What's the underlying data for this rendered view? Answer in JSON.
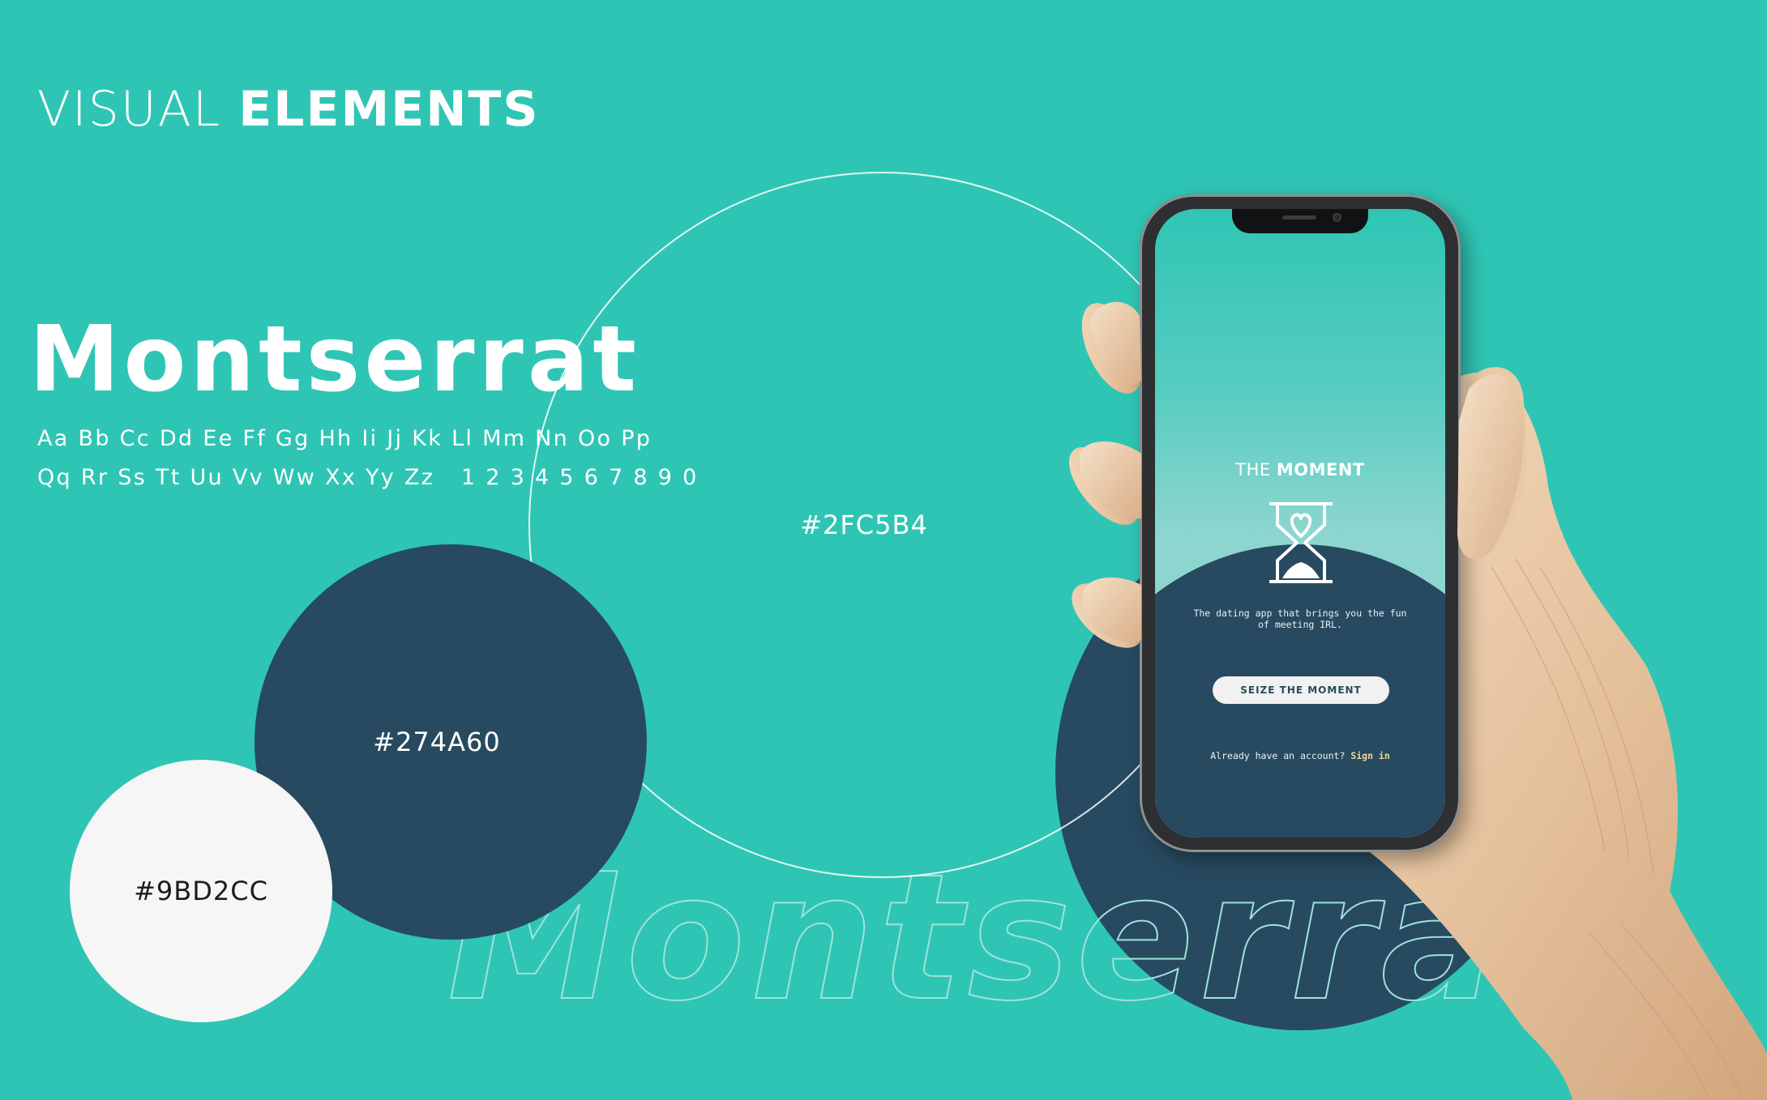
{
  "header": {
    "title_light": "VISUAL",
    "title_bold": "ELEMENTS"
  },
  "typography": {
    "font_name": "Montserrat",
    "alphabet_line1": "Aa Bb Cc Dd Ee Ff Gg Hh Ii Jj Kk Ll Mm Nn Oo Pp",
    "alphabet_line2": "Qq Rr Ss Tt Uu Vv Ww Xx Yy Zz   1 2 3 4 5 6 7 8 9 0",
    "watermark": "Montserrat"
  },
  "palette": [
    {
      "hex": "#2FC5B4",
      "color": "#2fc5b4"
    },
    {
      "hex": "#274A60",
      "color": "#274a60"
    },
    {
      "hex": "#9BD2CC",
      "color": "#f6f6f6"
    }
  ],
  "phone": {
    "app_title_light": "THE",
    "app_title_bold": "MOMENT",
    "logo_icon": "hourglass-heart-icon",
    "tagline": "The dating app that brings you the fun of meeting IRL.",
    "cta_label": "SEIZE THE MOMENT",
    "signin_prompt": "Already have an account?",
    "signin_link": "Sign in"
  },
  "colors": {
    "background": "#2fc5b4",
    "dark": "#274a60",
    "light": "#f6f6f6",
    "accent_link": "#f0d79a"
  }
}
